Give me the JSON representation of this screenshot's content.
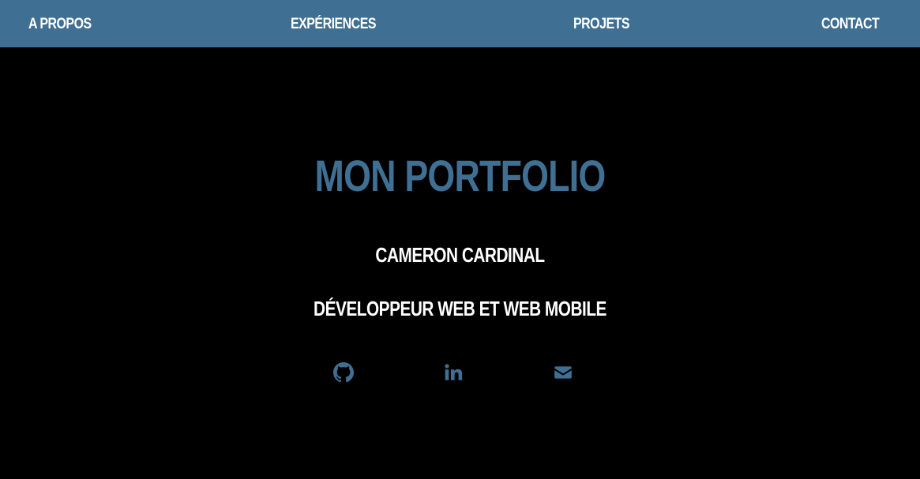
{
  "nav": {
    "apropos": "A PROPOS",
    "experiences": "EXPÉRIENCES",
    "projets": "PROJETS",
    "contact": "CONTACT"
  },
  "hero": {
    "title": "MON PORTFOLIO",
    "name": "CAMERON CARDINAL",
    "role": "DÉVELOPPEUR WEB ET WEB MOBILE"
  },
  "social": {
    "icons": [
      "github-icon",
      "linkedin-icon",
      "envelope-icon"
    ]
  },
  "colors": {
    "accent": "#3f6f92",
    "background": "#000000",
    "text": "#ffffff"
  }
}
